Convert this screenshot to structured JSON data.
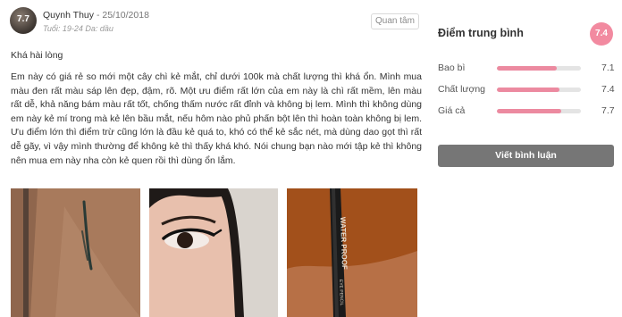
{
  "review": {
    "avatar_score": "7.7",
    "reviewer_name": "Quynh Thuy",
    "date": "- 25/10/2018",
    "meta": "Tuổi: 19-24  Da: dầu",
    "follow_label": "Quan tâm",
    "title": "Khá hài lòng",
    "body": "Em này có giá rẻ so mới một cây chì kẻ mắt, chỉ dưới 100k mà chất lượng thì khá ổn. Mình mua màu đen rất màu sáp lên đẹp, đậm, rõ. Một ưu điểm rất lớn của em này là chì rất mềm, lên màu rất dễ, khả năng bám màu rất tốt, chống thấm nước rất đỉnh và không bị lem. Mình thì không dùng em này kẻ mí trong mà kẻ lên bầu mắt, nếu hôm nào phủ phấn bột lên thì hoàn toàn không bị lem. Ưu điểm lớn thì điểm trừ cũng lớn là đầu kẻ quá to, khó có thể kẻ sắc nét, mà dùng dao gọt thì rất dễ gãy, vì vậy mình thường để không kẻ thì thấy khá khó. Nói chung bạn nào mới tập kẻ thì không nên mua em này nha còn kẻ quen rồi thì dùng ổn lắm.",
    "photo3_text": "WATER PROOF",
    "photo3_subtext": "EYE PENCIL"
  },
  "summary": {
    "title": "Điểm trung bình",
    "average": "7.4",
    "ratings": [
      {
        "label": "Bao bì",
        "value": "7.1",
        "fraction": 0.71
      },
      {
        "label": "Chất lượng",
        "value": "7.4",
        "fraction": 0.74
      },
      {
        "label": "Giá cả",
        "value": "7.7",
        "fraction": 0.77
      }
    ],
    "write_button": "Viết bình luận"
  },
  "colors": {
    "accent": "#ec8aa0",
    "badge": "#f28aa0",
    "button": "#767676"
  }
}
